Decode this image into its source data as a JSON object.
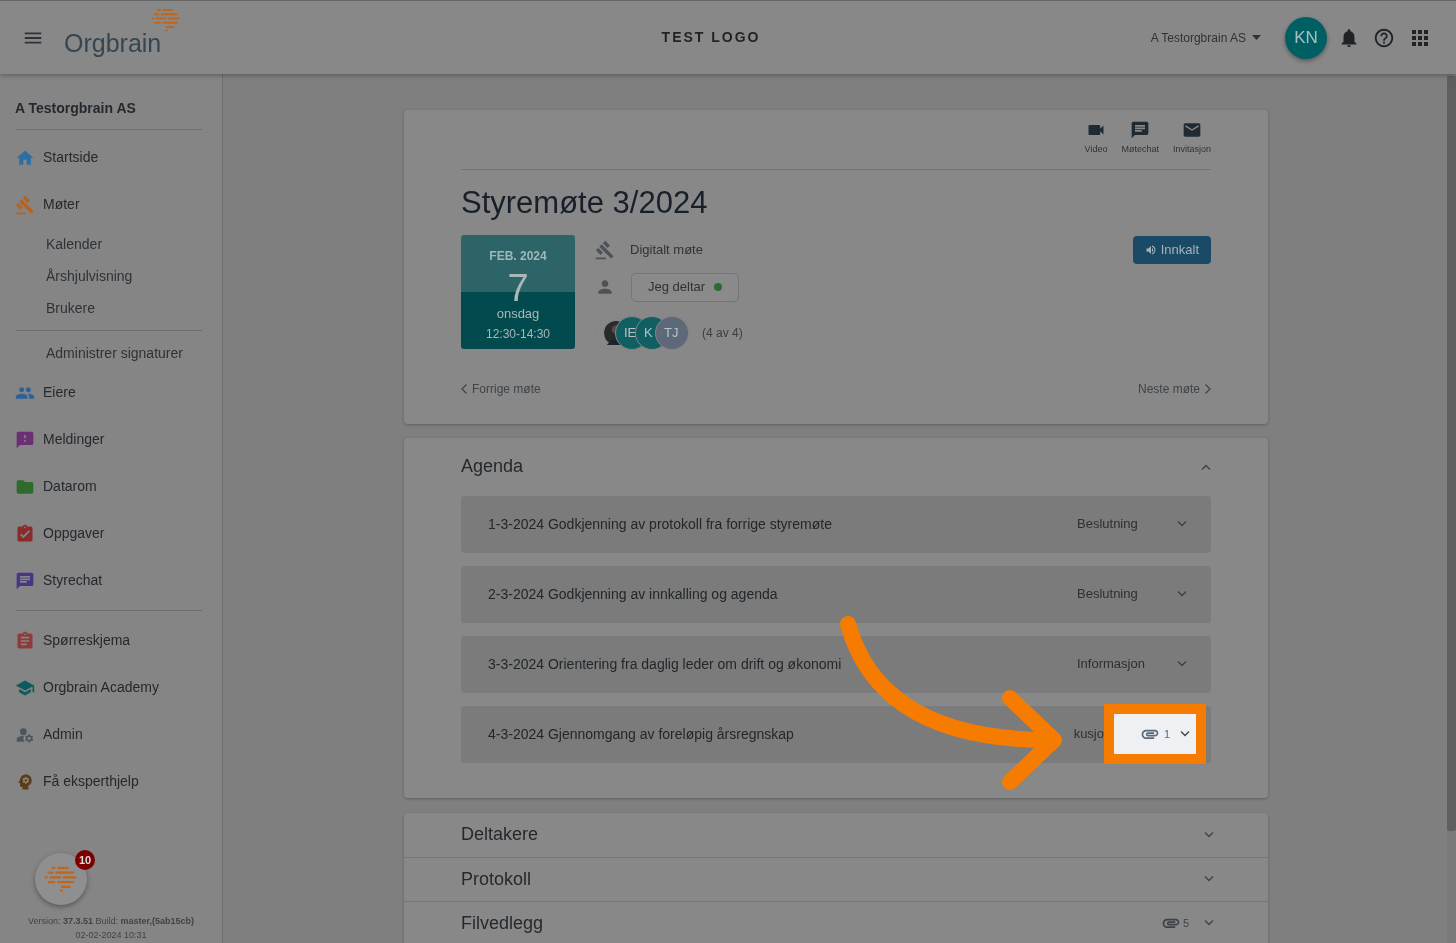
{
  "header": {
    "logo": "Orgbrain",
    "center_title": "TEST LOGO",
    "org_selector": "A Testorgbrain AS",
    "avatar": "KN"
  },
  "sidebar": {
    "org": "A Testorgbrain AS",
    "items": [
      {
        "kind": "nav",
        "label": "Startside",
        "color": "#2f6ea3"
      },
      {
        "kind": "nav",
        "label": "Møter",
        "color": "#b8621a"
      },
      {
        "kind": "sub",
        "label": "Kalender"
      },
      {
        "kind": "sub",
        "label": "Årshjulvisning"
      },
      {
        "kind": "sub",
        "label": "Brukere"
      },
      {
        "kind": "divider"
      },
      {
        "kind": "sub",
        "label": "Administrer signaturer"
      },
      {
        "kind": "nav",
        "label": "Eiere",
        "color": "#2f5f9a"
      },
      {
        "kind": "nav",
        "label": "Meldinger",
        "color": "#6a2f74"
      },
      {
        "kind": "nav",
        "label": "Datarom",
        "color": "#2f6a2f"
      },
      {
        "kind": "nav",
        "label": "Oppgaver",
        "color": "#8a2b2b"
      },
      {
        "kind": "nav",
        "label": "Styrechat",
        "color": "#4a3585"
      },
      {
        "kind": "divider"
      },
      {
        "kind": "nav",
        "label": "Spørreskjema",
        "color": "#8e3b3b"
      },
      {
        "kind": "nav",
        "label": "Orgbrain Academy",
        "color": "#0f5a5e"
      },
      {
        "kind": "nav",
        "label": "Admin",
        "color": "#4d555c"
      },
      {
        "kind": "nav",
        "label": "Få eksperthjelp",
        "color": "#5a3b1a"
      }
    ],
    "badge": "10",
    "version": "Version: **37.3.51** Build: **master,(5ab15cb)**",
    "build_date": "02-02-2024 10:31"
  },
  "meeting": {
    "actions": [
      "Video",
      "Møtechat",
      "Invitasjon"
    ],
    "title": "Styremøte 3/2024",
    "date": {
      "month": "FEB. 2024",
      "day": "7",
      "weekday": "onsdag",
      "time": "12:30-14:30"
    },
    "type": "Digitalt møte",
    "attendance": {
      "label": "Jeg deltar",
      "color": "#2e6b30"
    },
    "participants": [
      {
        "kind": "picture"
      },
      {
        "kind": "initials",
        "initials": "IE",
        "color": "#0f5f63"
      },
      {
        "kind": "initials",
        "initials": "K",
        "color": "#0f5f63"
      },
      {
        "kind": "initials",
        "initials": "TJ",
        "color": "#5d6878"
      }
    ],
    "participant_count": "(4 av 4)",
    "status": "Innkalt",
    "previous": "Forrige møte",
    "next": "Neste møte"
  },
  "agenda": {
    "title": "Agenda",
    "expanded": true,
    "items": [
      {
        "title": "1-3-2024 Godkjenning av protokoll fra forrige styremøte",
        "type": "Beslutning",
        "highlighted": false
      },
      {
        "title": "2-3-2024 Godkjenning av innkalling og agenda",
        "type": "Beslutning",
        "highlighted": false
      },
      {
        "title": "3-3-2024 Orientering fra daglig leder om drift og økonomi",
        "type": "Informasjon",
        "highlighted": false
      },
      {
        "title": "4-3-2024 Gjennomgang av foreløpig årsregnskap",
        "type": "kusjo",
        "attachments": "1",
        "highlighted": true
      }
    ]
  },
  "sections": [
    {
      "title": "Deltakere",
      "expanded": false
    },
    {
      "title": "Protokoll",
      "expanded": false
    },
    {
      "title": "Filvedlegg",
      "attachments": "5",
      "expanded": false
    }
  ]
}
